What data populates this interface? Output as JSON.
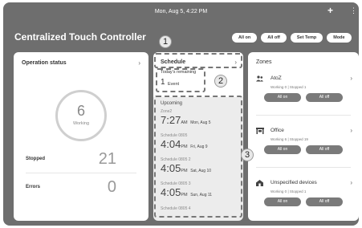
{
  "status_bar": {
    "datetime": "Mon, Aug 5, 4:22 PM",
    "add_symbol": "+",
    "more_symbol": "⋮"
  },
  "app": {
    "title": "Centralized Touch Controller"
  },
  "header_actions": [
    {
      "label": "All on"
    },
    {
      "label": "All off"
    },
    {
      "label": "Set Temp"
    },
    {
      "label": "Mode"
    }
  ],
  "operation_status": {
    "title": "Operation status",
    "working_count": "6",
    "working_label": "Working",
    "stopped_label": "Stopped",
    "stopped_value": "21",
    "errors_label": "Errors",
    "errors_value": "0"
  },
  "schedule": {
    "title": "Schedule",
    "remaining_label": "Today's remaining",
    "remaining_count": "1",
    "remaining_unit": "Event",
    "upcoming_label": "Upcoming",
    "events": [
      {
        "name": "Zone2",
        "time": "7:27",
        "ampm": "AM",
        "date": "Mon, Aug 5"
      },
      {
        "name": "Schedule 0805",
        "time": "4:04",
        "ampm": "PM",
        "date": "Fri, Aug 9"
      },
      {
        "name": "Schedule 0805 2",
        "time": "4:05",
        "ampm": "PM",
        "date": "Sat, Aug 10"
      },
      {
        "name": "Schedule 0805 3",
        "time": "4:05",
        "ampm": "PM",
        "date": "Sun, Aug 11"
      },
      {
        "name": "Schedule 0805 4"
      }
    ]
  },
  "zones": {
    "title": "Zones",
    "items": [
      {
        "name": "AtoZ",
        "icon": "people-icon",
        "working": "Working 0",
        "stopped": "Stopped 1",
        "on_label": "All on",
        "off_label": "All off"
      },
      {
        "name": "Office",
        "icon": "office-icon",
        "working": "Working 6",
        "stopped": "Stopped 19",
        "on_label": "All on",
        "off_label": "All off"
      },
      {
        "name": "Unspecified devices",
        "icon": "building-icon",
        "working": "Working 0",
        "stopped": "Stopped 1",
        "on_label": "All on",
        "off_label": "All off"
      }
    ]
  },
  "callouts": [
    "1",
    "2",
    "3"
  ]
}
